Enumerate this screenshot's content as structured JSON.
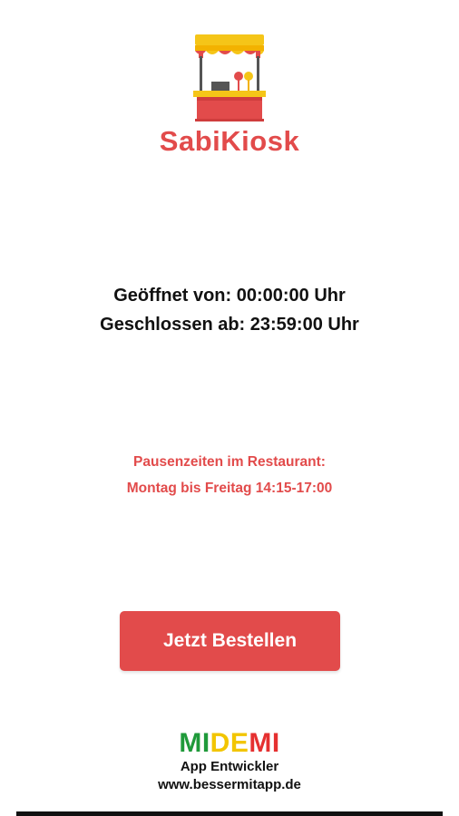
{
  "brand": {
    "name": "SabiKiosk",
    "icon": "kiosk-stand-icon",
    "color": "#e24b4b"
  },
  "hours": {
    "open": "Geöffnet von: 00:00:00 Uhr",
    "closed": "Geschlossen ab: 23:59:00 Uhr"
  },
  "pause": {
    "title": "Pausenzeiten im Restaurant:",
    "times": "Montag bis Freitag 14:15-17:00"
  },
  "order_button": {
    "label": "Jetzt Bestellen",
    "color": "#e24b4b"
  },
  "developer": {
    "logo_parts": [
      "MI",
      "DE",
      "MI"
    ],
    "logo_colors": [
      "#1f9a3a",
      "#f2c500",
      "#e53030"
    ],
    "tagline": "App Entwickler",
    "website": "www.bessermitapp.de"
  }
}
